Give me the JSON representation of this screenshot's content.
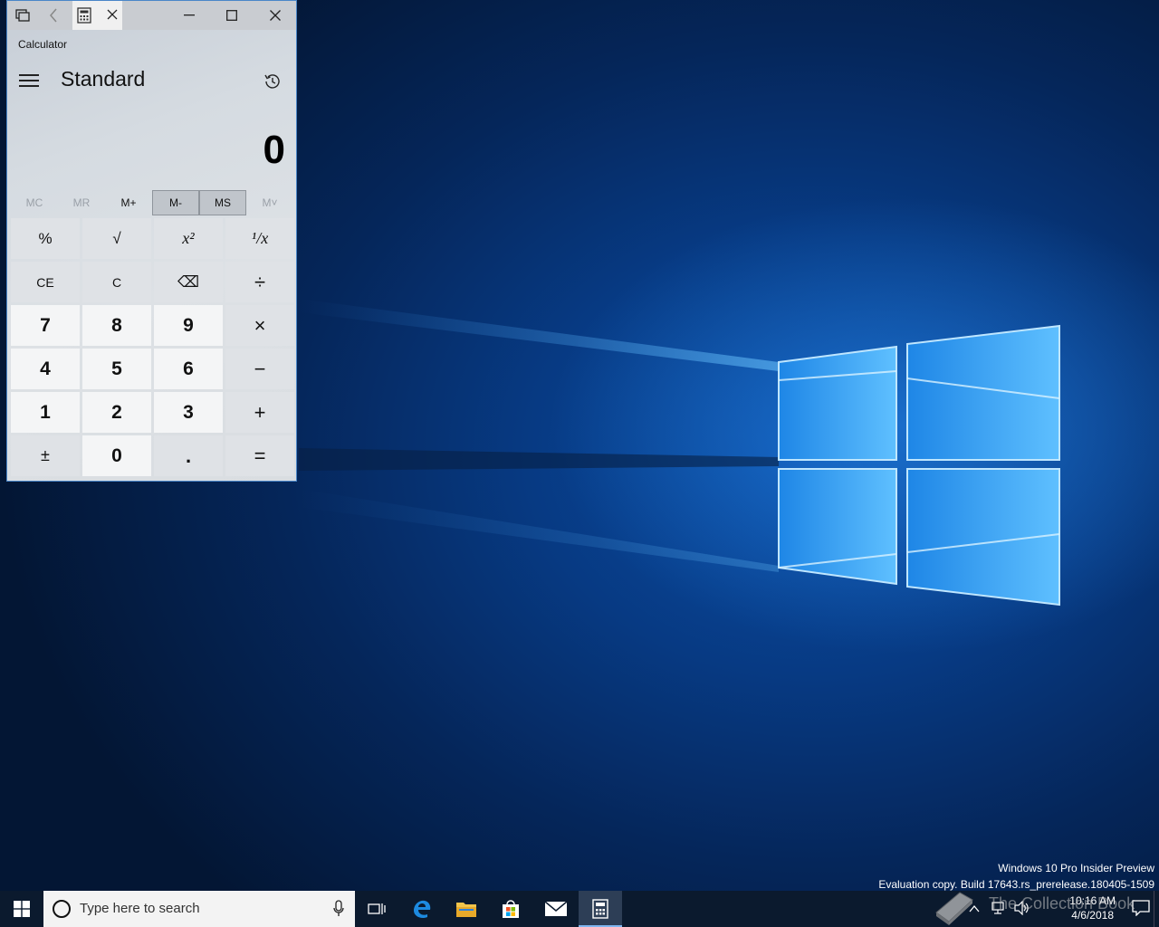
{
  "calculator": {
    "app_label": "Calculator",
    "mode": "Standard",
    "display_value": "0",
    "memory": [
      "MC",
      "MR",
      "M+",
      "M-",
      "MS",
      "M˅"
    ],
    "keys": [
      [
        "%",
        "√",
        "x²",
        "¹/x"
      ],
      [
        "CE",
        "C",
        "⌫",
        "÷"
      ],
      [
        "7",
        "8",
        "9",
        "×"
      ],
      [
        "4",
        "5",
        "6",
        "−"
      ],
      [
        "1",
        "2",
        "3",
        "+"
      ],
      [
        "±",
        "0",
        ".",
        "="
      ]
    ]
  },
  "desktop": {
    "watermark_line1": "Windows 10 Pro Insider Preview",
    "watermark_line2": "Evaluation copy. Build 17643.rs_prerelease.180405-1509"
  },
  "taskbar": {
    "search_placeholder": "Type here to search",
    "time": "10:16 AM",
    "date": "4/6/2018",
    "watermark": "The Collection Book",
    "pinned_apps": [
      "task-view",
      "edge",
      "file-explorer",
      "store",
      "mail",
      "calculator"
    ]
  }
}
